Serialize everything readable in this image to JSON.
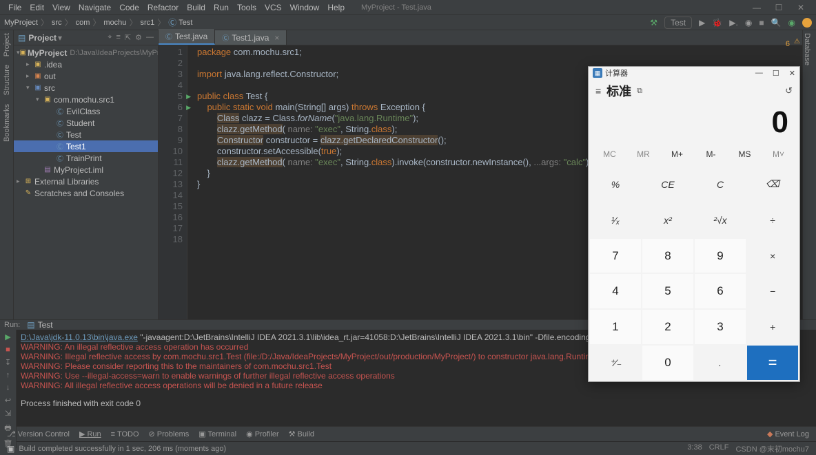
{
  "menubar": {
    "items": [
      "File",
      "Edit",
      "View",
      "Navigate",
      "Code",
      "Refactor",
      "Build",
      "Run",
      "Tools",
      "VCS",
      "Window",
      "Help"
    ],
    "project": "MyProject - Test.java"
  },
  "breadcrumb": {
    "parts": [
      "MyProject",
      "src",
      "com",
      "mochu",
      "src1",
      "Test"
    ],
    "run_config": "Test"
  },
  "project_panel": {
    "title": "Project",
    "root": {
      "name": "MyProject",
      "path": "D:\\Java\\IdeaProjects\\MyProject"
    },
    "nodes": [
      ".idea",
      "out",
      "src",
      "com.mochu.src1",
      "EvilClass",
      "Student",
      "Test",
      "Test1",
      "TrainPrint",
      "MyProject.iml",
      "External Libraries",
      "Scratches and Consoles"
    ]
  },
  "editor": {
    "tabs": [
      {
        "label": "Test.java",
        "active": true
      },
      {
        "label": "Test1.java",
        "active": false
      }
    ],
    "line_numbers": [
      "1",
      "2",
      "3",
      "4",
      "5",
      "6",
      "7",
      "8",
      "9",
      "10",
      "11",
      "12",
      "13",
      "14",
      "15",
      "16",
      "17",
      "18"
    ],
    "code": {
      "l1_pkg": "package",
      "l1_rest": " com.mochu.src1;",
      "l3_imp": "import",
      "l3_rest": " java.lang.reflect.Constructor;",
      "l5": "public class Test {",
      "l6": "public static void ",
      "l6_main": "main",
      "l6_args": "(String[] args) ",
      "l6_throws": "throws",
      "l6_exc": " Exception {",
      "l7a": "Class",
      "l7b": " clazz = Class.",
      "l7c": "forName",
      "l7d": "(",
      "l7e": "\"java.lang.Runtime\"",
      "l7f": ");",
      "l8a": "clazz.getMethod( ",
      "l8p": "name: ",
      "l8b": "\"exec\"",
      "l8c": ", String.",
      "l8d": "class",
      "l8e": ");",
      "l9a": "Constructor",
      "l9b": " constructor = ",
      "l9c": "clazz.getDeclaredConstructor",
      "l9d": "();",
      "l10": "constructor.setAccessible(",
      "l10t": "true",
      "l10e": ");",
      "l11a": "clazz.getMethod( ",
      "l11p": "name: ",
      "l11b": "\"exec\"",
      "l11c": ", String.",
      "l11d": "class",
      "l11e": ").invoke(constructor.newInstance(), ",
      "l11p2": "...args: ",
      "l11f": "\"calc\"",
      "l11g": ");",
      "l12": "    }",
      "l13": "}"
    },
    "warn_count": "6"
  },
  "console": {
    "header": "Run:",
    "tab": "Test",
    "path": "D:\\Java\\jdk-11.0.13\\bin\\java.exe",
    "pathrest": " \"-javaagent:D:\\JetBrains\\IntelliJ IDEA 2021.3.1\\lib\\idea_rt.jar=41058:D:\\JetBrains\\IntelliJ IDEA 2021.3.1\\bin\" -Dfile.encoding=UT",
    "lines": [
      "WARNING: An illegal reflective access operation has occurred",
      "WARNING: Illegal reflective access by com.mochu.src1.Test (file:/D:/Java/IdeaProjects/MyProject/out/production/MyProject/) to constructor java.lang.Runtime()",
      "WARNING: Please consider reporting this to the maintainers of com.mochu.src1.Test",
      "WARNING: Use --illegal-access=warn to enable warnings of further illegal reflective access operations",
      "WARNING: All illegal reflective access operations will be denied in a future release"
    ],
    "exit": "Process finished with exit code 0"
  },
  "bottom": {
    "items": [
      "Version Control",
      "Run",
      "TODO",
      "Problems",
      "Terminal",
      "Profiler",
      "Build"
    ],
    "eventlog": "Event Log"
  },
  "status": {
    "msg": "Build completed successfully in 1 sec, 206 ms (moments ago)",
    "pos": "3:38",
    "enc": "CRLF",
    "watermark": "CSDN @末初mochu7"
  },
  "calc": {
    "title": "计算器",
    "mode": "标准",
    "display": "0",
    "mem": [
      "MC",
      "MR",
      "M+",
      "M-",
      "MS",
      "M˅"
    ],
    "grid": [
      {
        "t": "%",
        "c": "fn"
      },
      {
        "t": "CE",
        "c": "fn"
      },
      {
        "t": "C",
        "c": "fn"
      },
      {
        "t": "⌫",
        "c": "fn"
      },
      {
        "t": "¹⁄ₓ",
        "c": "fn"
      },
      {
        "t": "x²",
        "c": "fn"
      },
      {
        "t": "²√x",
        "c": "fn"
      },
      {
        "t": "÷",
        "c": "fn"
      },
      {
        "t": "7",
        "c": "num"
      },
      {
        "t": "8",
        "c": "num"
      },
      {
        "t": "9",
        "c": "num"
      },
      {
        "t": "×",
        "c": "fn"
      },
      {
        "t": "4",
        "c": "num"
      },
      {
        "t": "5",
        "c": "num"
      },
      {
        "t": "6",
        "c": "num"
      },
      {
        "t": "−",
        "c": "fn"
      },
      {
        "t": "1",
        "c": "num"
      },
      {
        "t": "2",
        "c": "num"
      },
      {
        "t": "3",
        "c": "num"
      },
      {
        "t": "+",
        "c": "fn"
      },
      {
        "t": "⁺⁄₋",
        "c": "fn"
      },
      {
        "t": "0",
        "c": "num"
      },
      {
        "t": ".",
        "c": "fn"
      },
      {
        "t": "=",
        "c": "eq"
      }
    ]
  }
}
